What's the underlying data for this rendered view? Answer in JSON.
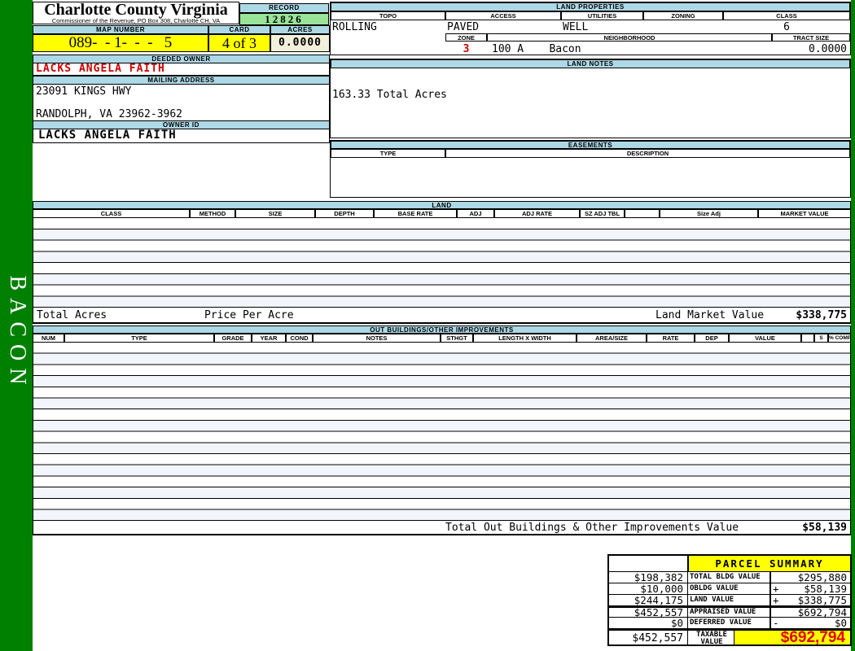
{
  "app": {
    "title": "Charlotte County Virginia",
    "subtitle": "Commissioner of the Revenue, PO Box 308, Charlotte CH, VA"
  },
  "sidebar": {
    "vertical_label": "BACON"
  },
  "record": {
    "label": "RECORD",
    "value": "12826"
  },
  "map": {
    "map_number_label": "MAP NUMBER",
    "map_number": "089-  - 1-  -  -   5",
    "card_label": "CARD",
    "card": "4 of 3",
    "acres_label": "ACRES",
    "acres": "0.0000"
  },
  "owner": {
    "deeded_owner_label": "DEEDED OWNER",
    "deeded_owner": "LACKS ANGELA FAITH",
    "mailing_address_label": "MAILING ADDRESS",
    "address_line1": "23091 KINGS HWY",
    "address_line2": "RANDOLPH, VA 23962-3962",
    "owner_id_label": "OWNER ID",
    "owner_id": "LACKS ANGELA FAITH"
  },
  "land_properties": {
    "title": "LAND PROPERTIES",
    "headers": [
      "TOPO",
      "ACCESS",
      "UTILITIES",
      "ZONING",
      "CLASS"
    ],
    "topo": "ROLLING",
    "access": "PAVED",
    "utilities": "WELL",
    "zoning": "",
    "class": "6",
    "zone_label": "ZONE",
    "zone": "3",
    "neighborhood_label": "NEIGHBORHOOD",
    "neighborhood": "100 A    Bacon",
    "tract_size_label": "TRACT SIZE",
    "tract_size": "0.0000"
  },
  "land_notes": {
    "title": "LAND NOTES",
    "note": "163.33 Total Acres"
  },
  "easements": {
    "title": "EASEMENTS",
    "type_label": "TYPE",
    "description_label": "DESCRIPTION"
  },
  "land": {
    "title": "LAND",
    "columns": [
      "CLASS",
      "METHOD",
      "SIZE",
      "DEPTH",
      "BASE RATE",
      "ADJ",
      "ADJ RATE",
      "SZ ADJ TBL",
      "",
      "Size Adj",
      "MARKET VALUE"
    ],
    "total_acres_label": "Total Acres",
    "price_per_acre_label": "Price Per Acre",
    "market_value_label": "Land Market Value",
    "market_value": "$338,775"
  },
  "out_buildings": {
    "title": "OUT BUILDINGS/OTHER IMPROVEMENTS",
    "columns": [
      "NUM",
      "TYPE",
      "GRADE",
      "YEAR",
      "COND",
      "NOTES",
      "STHGT",
      "LENGTH X WIDTH",
      "AREA/SIZE",
      "RATE",
      "DEP",
      "VALUE",
      "",
      "S",
      "% COMP"
    ],
    "total_label": "Total Out Buildings & Other Improvements Value",
    "total_value": "$58,139"
  },
  "parcel_summary": {
    "title": "PARCEL SUMMARY",
    "rows": [
      {
        "prior": "$198,382",
        "label": "TOTAL BLDG VALUE",
        "op": "",
        "value": "$295,880"
      },
      {
        "prior": "$10,000",
        "label": "OBLDG VALUE",
        "op": "+",
        "value": "$58,139"
      },
      {
        "prior": "$244,175",
        "label": "LAND VALUE",
        "op": "+",
        "value": "$338,775"
      },
      {
        "prior": "$452,557",
        "label": "APPRAISED VALUE",
        "op": "",
        "value": "$692,794"
      },
      {
        "prior": "$0",
        "label": "DEFERRED VALUE",
        "op": "-",
        "value": "$0"
      },
      {
        "prior": "$452,557",
        "label": "TAXABLE VALUE",
        "op": "",
        "value": "$692,794"
      }
    ]
  },
  "colors": {
    "page_background": "#008000",
    "section_header": "#ADD8E6",
    "highlight_yellow": "#FFFF00",
    "record_green": "#99E499",
    "acres_cream": "#F2EFDB",
    "alert_red": "#CC0000",
    "taxable_red": "#E00000"
  }
}
